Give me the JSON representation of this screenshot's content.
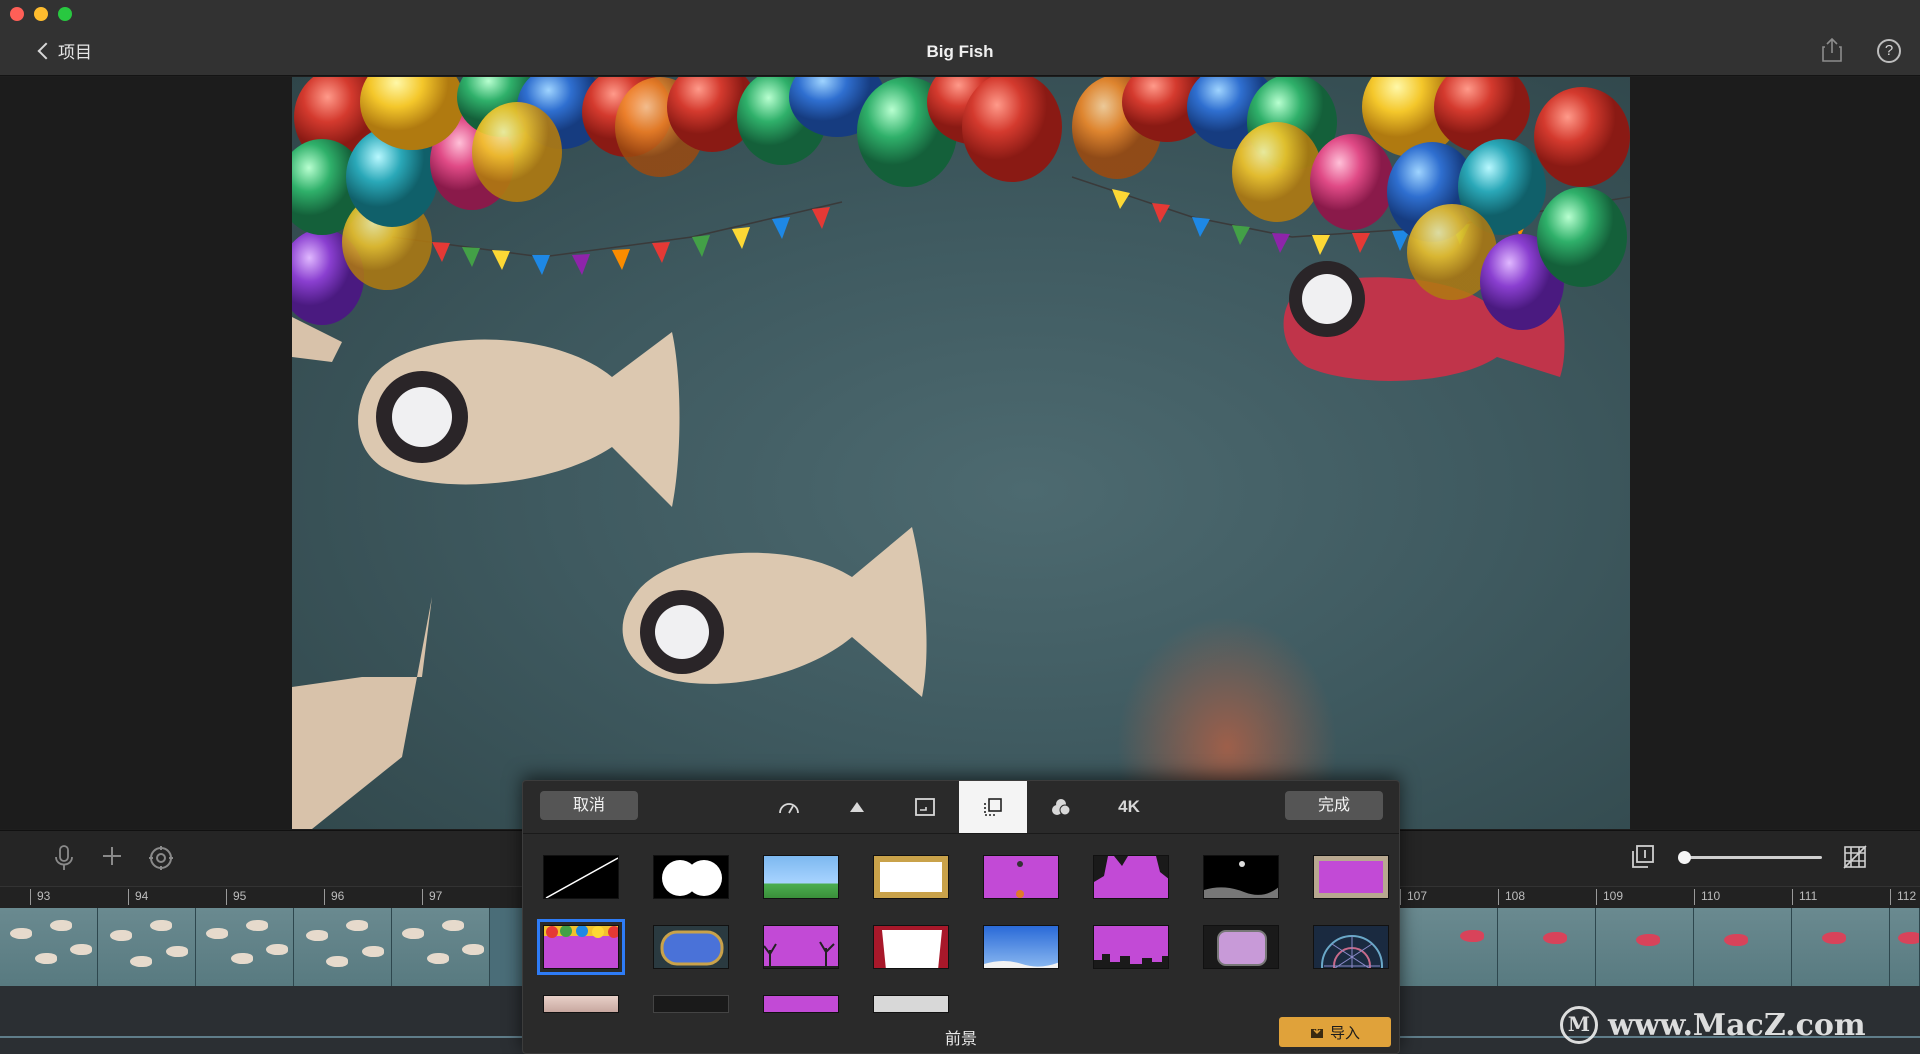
{
  "window": {
    "title": "Big Fish",
    "back_label": "项目",
    "help_glyph": "?"
  },
  "toolbar": {
    "icons": [
      "microphone-icon",
      "plus-icon",
      "settings-icon",
      "pages-icon",
      "grid-off-icon"
    ],
    "zoom_level": 0.0
  },
  "timeline": {
    "ticks": [
      "93",
      "94",
      "95",
      "96",
      "97",
      "107",
      "108",
      "109",
      "110",
      "111",
      "112"
    ]
  },
  "popover": {
    "cancel_label": "取消",
    "done_label": "完成",
    "tabs": [
      {
        "icon": "speed-icon",
        "label": ""
      },
      {
        "icon": "triangle-icon",
        "label": ""
      },
      {
        "icon": "crop-icon",
        "label": ""
      },
      {
        "icon": "overlay-icon",
        "label": "",
        "active": true
      },
      {
        "icon": "color-icon",
        "label": ""
      },
      {
        "icon": "",
        "label": "4K"
      }
    ],
    "section_label": "前景",
    "import_label": "导入",
    "thumbnails": [
      "none",
      "double-circle-mask",
      "sky-landscape",
      "gold-frame",
      "purple-screen",
      "palm-trees",
      "night-moon",
      "wood-frame",
      "balloons-party",
      "oval-window",
      "purple-trees",
      "curtain-stage",
      "blue-sky-snow",
      "city-silhouette",
      "tv-screen",
      "stained-window",
      "skin-texture",
      "dark-frame",
      "purple-plain",
      "grey-plain"
    ]
  },
  "watermark": "www.MacZ.com",
  "colors": {
    "accent": "#2e7cf6",
    "import": "#e0a23a",
    "chroma_purple": "#c24ad6"
  }
}
